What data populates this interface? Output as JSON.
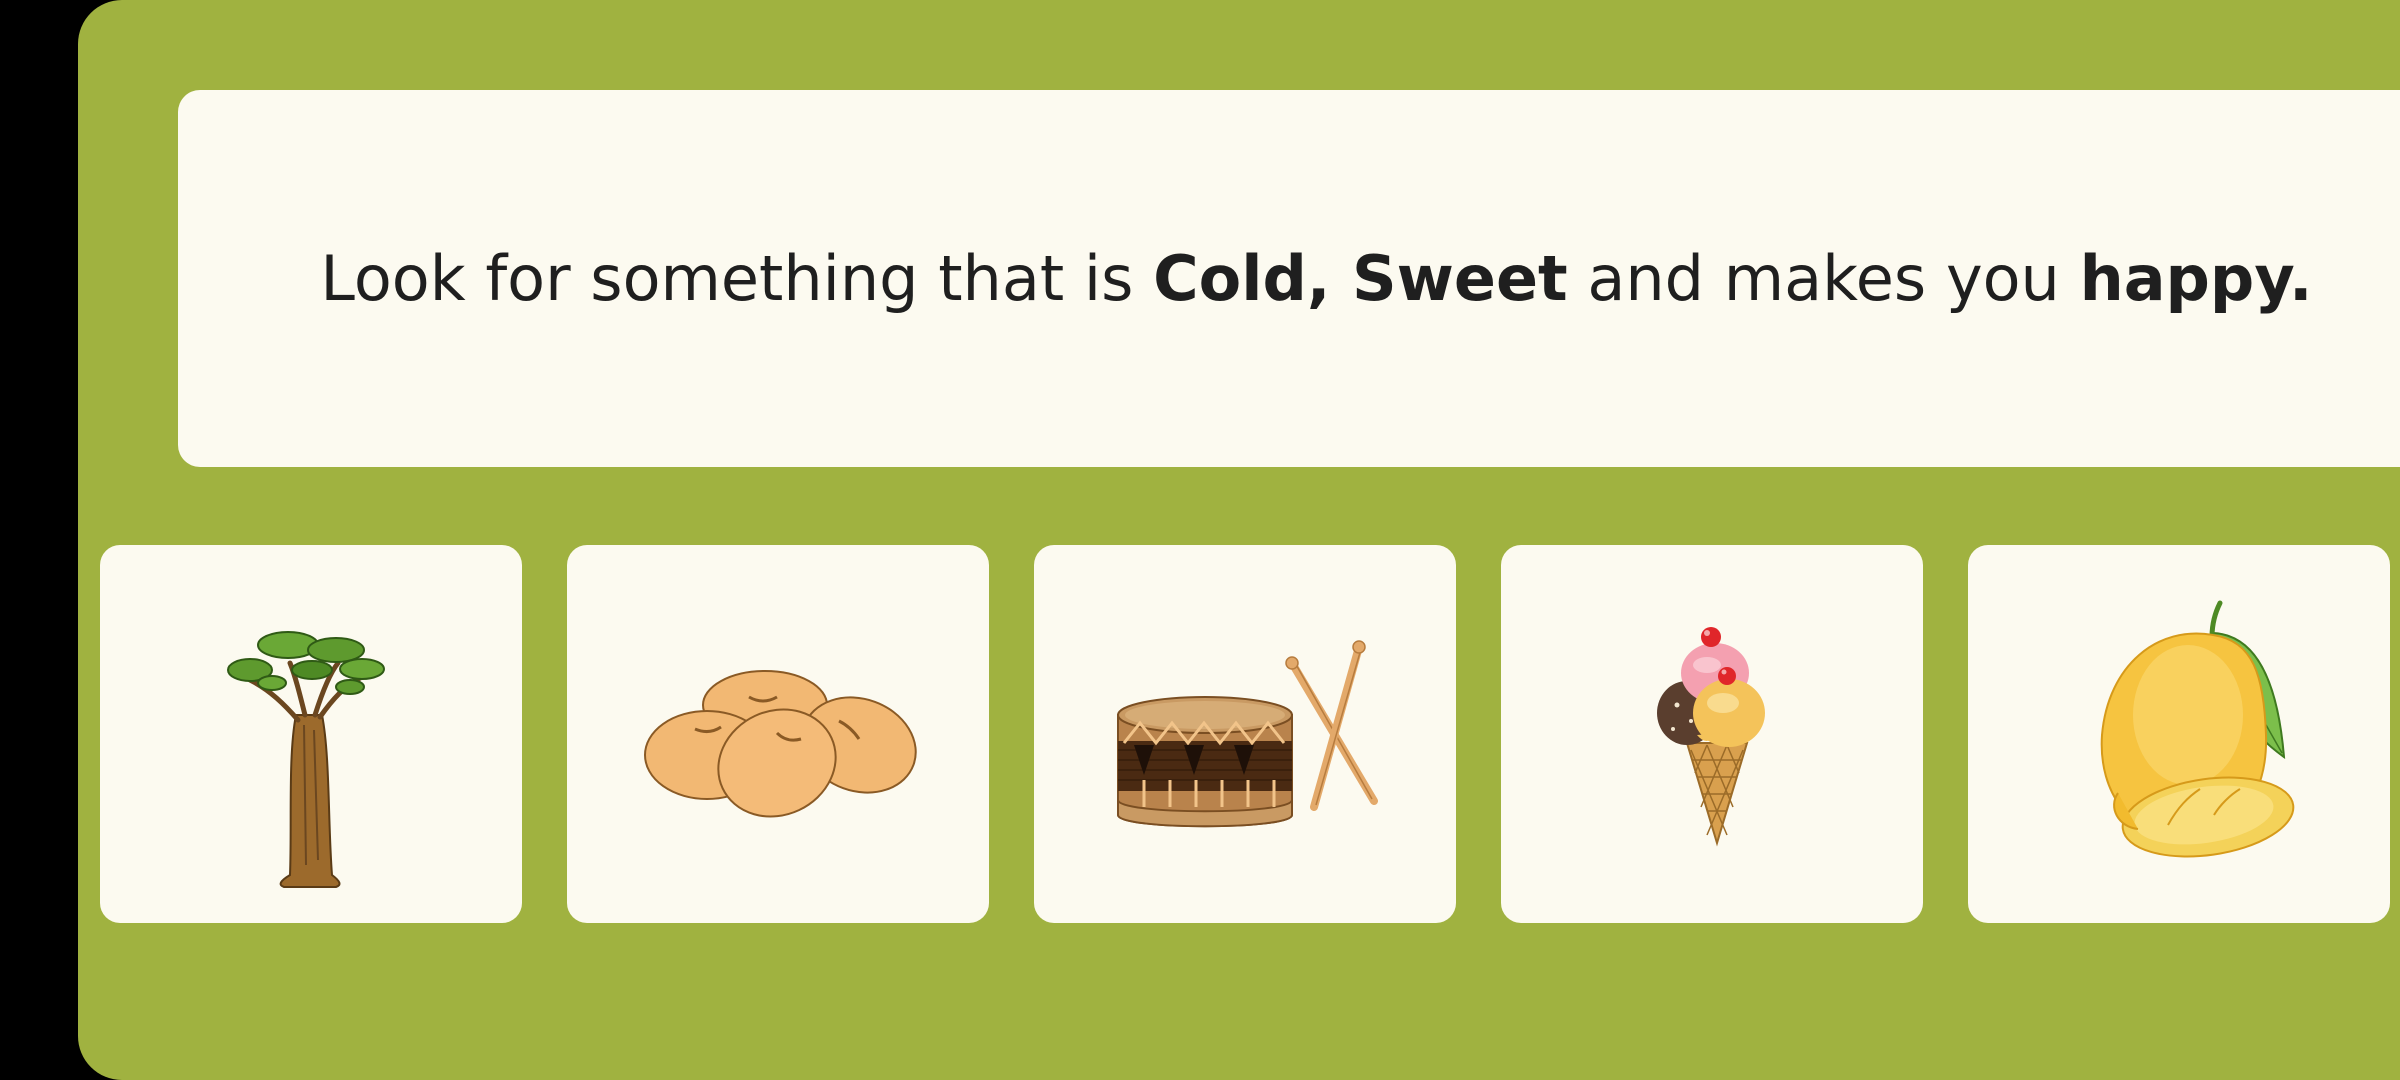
{
  "prompt": {
    "part1": "Look for something that is ",
    "bold1": "Cold, Sweet",
    "part2": " and makes you ",
    "bold2": "happy."
  },
  "options": [
    {
      "icon": "baobab-tree-icon"
    },
    {
      "icon": "beans-icon"
    },
    {
      "icon": "drum-icon"
    },
    {
      "icon": "ice-cream-icon"
    },
    {
      "icon": "mango-icon"
    }
  ],
  "colors": {
    "background": "#A0B240",
    "card": "#FCFAF0",
    "text": "#1F1F1F"
  }
}
